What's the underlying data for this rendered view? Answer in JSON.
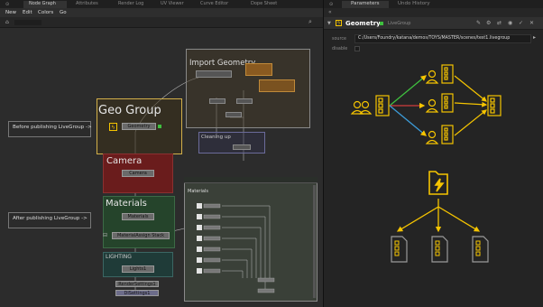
{
  "left_pane": {
    "tabs": [
      "Node Graph",
      "Attributes",
      "Render Log",
      "UV Viewer",
      "Curve Editor",
      "Dope Sheet"
    ],
    "menu": [
      "New",
      "Edit",
      "Colors",
      "Go"
    ],
    "annotations": {
      "before": "Before publishing LiveGroup ->",
      "after": "After publishing LiveGroup ->"
    },
    "geo_group": {
      "title": "Geo Group",
      "node": "Geometry"
    },
    "import_geometry": {
      "title": "Import Geometry"
    },
    "cleaning_up": {
      "title": "Cleaning up"
    },
    "camera": {
      "title": "Camera",
      "node": "Camera"
    },
    "materials": {
      "title": "Materials",
      "node": "Materials",
      "stack": "MaterialAssign Stack"
    },
    "lighting": {
      "title": "LIGHTING",
      "node": "Lights1"
    },
    "render_settings": "RenderSettings1",
    "dl_settings": "DlSettings1",
    "materials_panel_title": "Materials"
  },
  "right_pane": {
    "tabs": [
      "Parameters",
      "Undo History"
    ],
    "node_name": "Geometry",
    "node_type": "LiveGroup",
    "source_label": "source",
    "source_value": "C:/Users/Foundry/katana/demos/TOYS/MASTER/scenes/test1.livegroup",
    "disable_label": "disable"
  },
  "colors": {
    "accent_yellow": "#f5c400",
    "geo_group_border": "#d3b04a",
    "camera_fill": "#6a1c1c",
    "materials_fill": "#25442b",
    "lighting_fill": "#1f3b38",
    "link_green": "#3fbf3f",
    "link_red": "#d03c3c",
    "link_blue": "#3c9bd8"
  }
}
